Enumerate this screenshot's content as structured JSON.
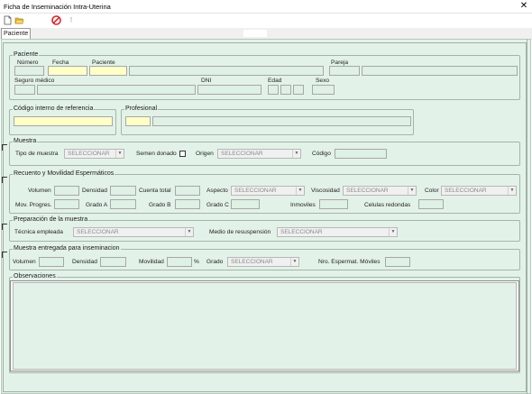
{
  "window": {
    "title": "Ficha de Inseminación Intra-Uterina",
    "close_glyph": "✕"
  },
  "toolbar": {
    "icons": [
      "new-document-icon",
      "open-folder-icon",
      "cancel-icon",
      "pin-icon"
    ]
  },
  "tabs": [
    {
      "label": "Paciente"
    },
    {
      "label": ""
    }
  ],
  "patient": {
    "group_label": "Paciente",
    "numero_label": "Número",
    "fecha_label": "Fecha",
    "paciente_label": "Paciente",
    "pareja_label": "Pareja",
    "seguro_label": "Seguro médico",
    "dni_label": "DNI",
    "edad_label": "Edad",
    "sexo_label": "Sexo"
  },
  "reference": {
    "group_label": "Código interno de referencia"
  },
  "professional": {
    "group_label": "Profesional"
  },
  "sample": {
    "group_label": "Muestra",
    "tipo_label": "Tipo de muestra",
    "tipo_value": "SELECCIONAR",
    "semen_label": "Semen donado",
    "origen_label": "Origen",
    "origen_value": "SELECCIONAR",
    "codigo_label": "Código"
  },
  "motility": {
    "group_label": "Recuento y Movilidad Espermáticos",
    "volumen_label": "Volumen",
    "densidad_label": "Densidad",
    "cuenta_label": "Cuenta total",
    "aspecto_label": "Aspecto",
    "aspecto_value": "SELECCIONAR",
    "viscosidad_label": "Viscosidad",
    "viscosidad_value": "SELECCIONAR",
    "color_label": "Color",
    "color_value": "SELECCIONAR",
    "movprog_label": "Mov. Progres.",
    "gradoa_label": "Grado A",
    "gradob_label": "Grado B",
    "gradoc_label": "Grado C",
    "inmoviles_label": "Inmoviles",
    "celulas_label": "Celulas redondas"
  },
  "preparation": {
    "group_label": "Preparación de la muestra",
    "tecnica_label": "Técnica empleada",
    "tecnica_value": "SELECCIONAR",
    "medio_label": "Medio de resuspensión",
    "medio_value": "SELECCIONAR"
  },
  "delivered": {
    "group_label": "Muestra entregada para inseminacion",
    "volumen_label": "Volumen",
    "densidad_label": "Densidad",
    "movilidad_label": "Movilidad",
    "percent": "%",
    "grado_label": "Grado",
    "grado_value": "SELECCIONAR",
    "nro_label": "Nro. Espermat. Móviles"
  },
  "observations": {
    "group_label": "Observaciones"
  },
  "colors": {
    "panel": "#e3f2e8",
    "highlight_field": "#ffffc8",
    "cancel_red": "#d9262c"
  }
}
